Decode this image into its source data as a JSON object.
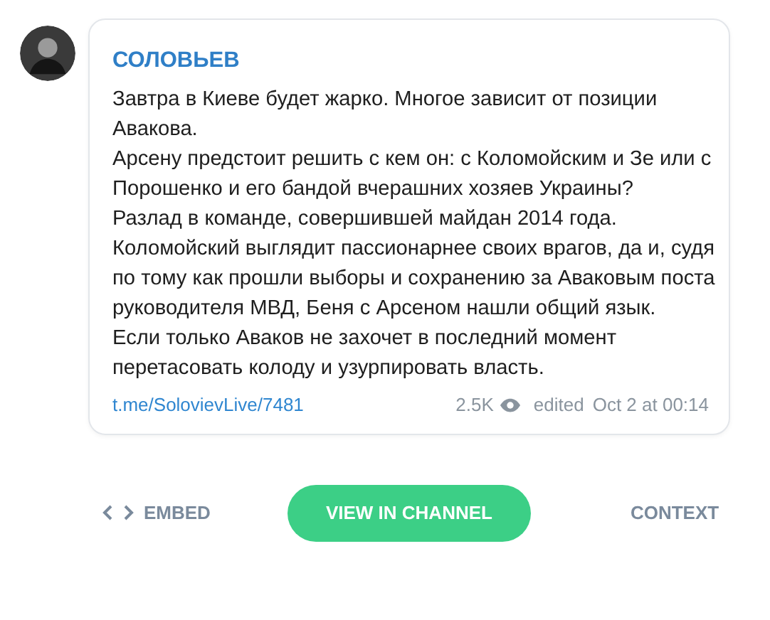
{
  "post": {
    "author": "СОЛОВЬЕВ",
    "paragraphs": [
      "Завтра в Киеве будет жарко. Многое зависит от позиции Авакова.",
      "Арсену предстоит решить с кем он: с Коломойским и Зе или с Порошенко и его бандой вчерашних хозяев Украины?",
      "Разлад в команде, совершившей майдан 2014 года.",
      "Коломойский выглядит пассионарнее своих врагов, да и, судя по тому как прошли выборы и сохранению за Аваковым поста руководителя МВД, Беня с Арсеном нашли общий язык.",
      "Если только Аваков не захочет в последний момент перетасовать колоду и узурпировать власть."
    ],
    "link": "t.me/SolovievLive/7481",
    "views": "2.5K",
    "edited": "edited",
    "date": "Oct 2 at 00:14"
  },
  "actions": {
    "embed": "EMBED",
    "view": "VIEW IN CHANNEL",
    "context": "CONTEXT"
  }
}
